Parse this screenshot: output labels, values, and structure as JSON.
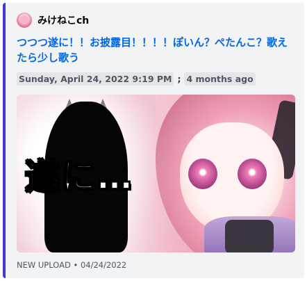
{
  "embed": {
    "accent_color": "#3f38d9",
    "author": {
      "name": "みけねこch",
      "avatar_icon": "avatar-icon"
    },
    "title": "つつつ遂に！！お披露目！！！！ぽいん？ぺたんこ？歌えたら少し歌う",
    "meta": {
      "datetime": "Sunday, April 24, 2022 9:19 PM",
      "separator": ";",
      "relative": "4 months ago"
    },
    "thumbnail": {
      "overlay_text": "遂に…"
    },
    "footer": {
      "label": "NEW UPLOAD",
      "bullet": "•",
      "date": "04/24/2022"
    }
  }
}
